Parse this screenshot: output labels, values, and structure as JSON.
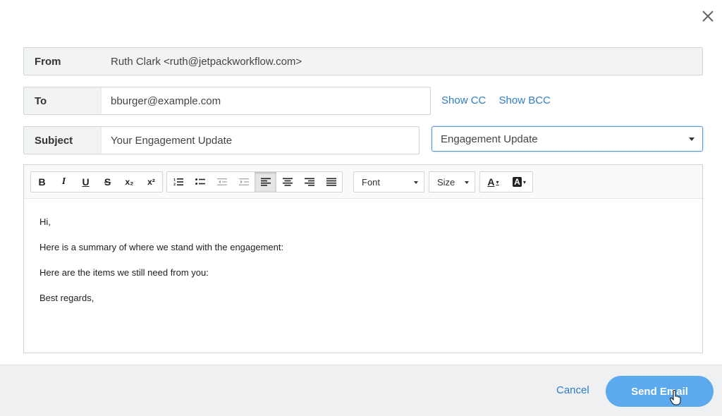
{
  "from": {
    "label": "From",
    "value": "Ruth Clark <ruth@jetpackworkflow.com>"
  },
  "to": {
    "label": "To",
    "value": "bburger@example.com"
  },
  "cc_links": {
    "show_cc": "Show CC",
    "show_bcc": "Show BCC"
  },
  "subject": {
    "label": "Subject",
    "value": "Your Engagement Update"
  },
  "template": {
    "selected": "Engagement Update"
  },
  "toolbar": {
    "bold": "B",
    "italic": "I",
    "underline": "U",
    "strike": "S",
    "subscript": "x₂",
    "superscript": "x²",
    "font_label": "Font",
    "size_label": "Size",
    "font_color": "A",
    "bg_color": "A"
  },
  "body": {
    "lines": [
      "Hi,",
      "Here is a summary of where we stand with the engagement:",
      "Here are the items we still need from you:",
      "Best regards,"
    ]
  },
  "footer": {
    "cancel": "Cancel",
    "send": "Send Email"
  },
  "colors": {
    "accent": "#2e7dc6",
    "send_button": "#5da9ee",
    "footer_bg": "#eef0f2"
  }
}
